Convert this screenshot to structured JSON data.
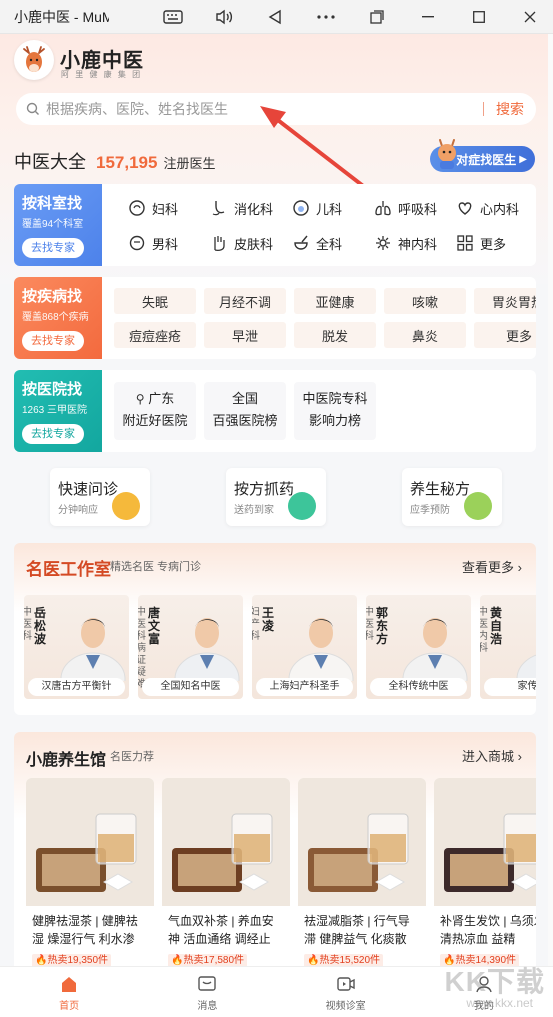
{
  "window": {
    "title": "小鹿中医 - MuMu"
  },
  "brand": {
    "name": "小鹿中医",
    "sub": "阿 里 健 康 集 团"
  },
  "search": {
    "placeholder": "根据疾病、医院、姓名找医生",
    "button": "搜索"
  },
  "stats": {
    "label": "中医大全",
    "count": "157,195",
    "suffix": "注册医生",
    "find_button": "对症找医生"
  },
  "by_department": {
    "title": "按科室找",
    "sub": "覆盖94个科室",
    "button": "去找专家",
    "items": [
      "妇科",
      "消化科",
      "儿科",
      "呼吸科",
      "心内科",
      "男科",
      "皮肤科",
      "全科",
      "神内科",
      "更多"
    ]
  },
  "by_disease": {
    "title": "按疾病找",
    "sub": "覆盖868个疾病",
    "button": "去找专家",
    "items": [
      "失眠",
      "月经不调",
      "亚健康",
      "咳嗽",
      "胃炎胃热",
      "痘痘痤疮",
      "早泄",
      "脱发",
      "鼻炎",
      "更多"
    ]
  },
  "by_hospital": {
    "title": "按医院找",
    "sub": "1263 三甲医院",
    "button": "去找专家",
    "items": [
      [
        "广东",
        "附近好医院"
      ],
      [
        "全国",
        "百强医院榜"
      ],
      [
        "中医院专科",
        "影响力榜"
      ]
    ]
  },
  "quick": [
    {
      "title": "快速问诊",
      "sub": "分钟响应",
      "color": "#f5b93b"
    },
    {
      "title": "按方抓药",
      "sub": "送药到家",
      "color": "#3dc59a"
    },
    {
      "title": "养生秘方",
      "sub": "应季预防",
      "color": "#9bd15a"
    }
  ],
  "doctors_section": {
    "title": "名医工作室",
    "sub": "精选名医 专病门诊",
    "more": "查看更多"
  },
  "doctors": [
    {
      "name": "岳松波",
      "tag": "中医科",
      "label": "汉唐古方平衡针"
    },
    {
      "name": "唐文富",
      "tag": "中医科 病证疑难",
      "label": "全国知名中医"
    },
    {
      "name": "王凌",
      "tag": "妇产科",
      "label": "上海妇产科圣手"
    },
    {
      "name": "郭东方",
      "tag": "中医科",
      "label": "全科传统中医"
    },
    {
      "name": "黄自浩",
      "tag": "中医内科",
      "label": "家传黄"
    }
  ],
  "shop_section": {
    "title": "小鹿养生馆",
    "sub": "名医力荐",
    "more": "进入商城"
  },
  "products": [
    {
      "name": "健脾祛湿茶 | 健脾祛湿 燥湿行气 利水渗",
      "sales": "热卖19,350件"
    },
    {
      "name": "气血双补茶 | 养血安神 活血通络 调经止",
      "sales": "热卖17,580件"
    },
    {
      "name": "祛湿减脂茶 | 行气导滞 健脾益气 化痰散",
      "sales": "热卖15,520件"
    },
    {
      "name": "补肾生发饮 | 乌须发 清热凉血 益精",
      "sales": "热卖14,390件"
    }
  ],
  "tabs": [
    "首页",
    "消息",
    "视频诊室",
    "我的"
  ],
  "watermark": {
    "main": "KK下载",
    "sub": "www.kkx.net"
  }
}
